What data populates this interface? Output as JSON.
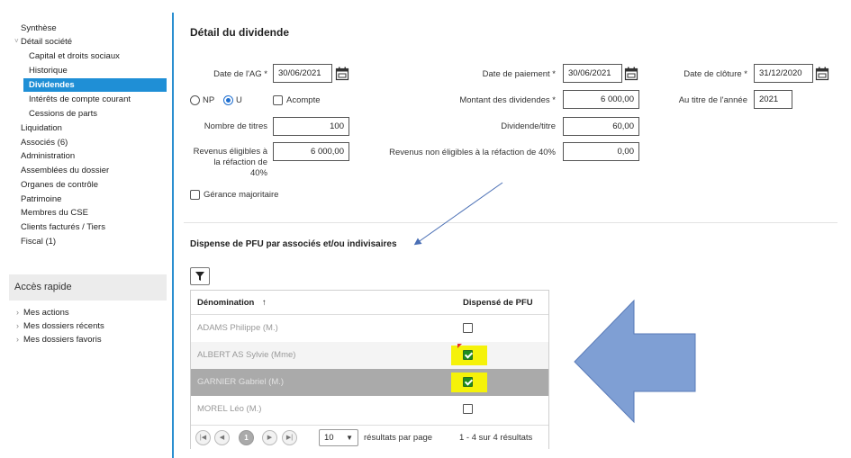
{
  "sidebar": {
    "items": [
      {
        "label": "Synthèse",
        "level": 1
      },
      {
        "label": "Détail société",
        "level": 1
      },
      {
        "label": "Capital et droits sociaux",
        "level": 2
      },
      {
        "label": "Historique",
        "level": 2
      },
      {
        "label": "Dividendes",
        "level": 2,
        "active": true
      },
      {
        "label": "Intérêts de compte courant",
        "level": 2
      },
      {
        "label": "Cessions de parts",
        "level": 2
      },
      {
        "label": "Liquidation",
        "level": 1
      },
      {
        "label": "Associés (6)",
        "level": 1
      },
      {
        "label": "Administration",
        "level": 1
      },
      {
        "label": "Assemblées du dossier",
        "level": 1
      },
      {
        "label": "Organes de contrôle",
        "level": 1
      },
      {
        "label": "Patrimoine",
        "level": 1
      },
      {
        "label": "Membres du CSE",
        "level": 1
      },
      {
        "label": "Clients facturés / Tiers",
        "level": 1
      },
      {
        "label": "Fiscal (1)",
        "level": 1
      }
    ],
    "quick_access": {
      "title": "Accès rapide",
      "items": [
        "Mes actions",
        "Mes dossiers récents",
        "Mes dossiers favoris"
      ]
    }
  },
  "main": {
    "title": "Détail du dividende",
    "date_ag": {
      "label": "Date de l'AG *",
      "value": "30/06/2021"
    },
    "date_paiement": {
      "label": "Date de paiement *",
      "value": "30/06/2021"
    },
    "date_cloture": {
      "label": "Date de clôture *",
      "value": "31/12/2020"
    },
    "radio_np": "NP",
    "radio_u": "U",
    "radio_selected": "U",
    "acompte": {
      "label": "Acompte",
      "checked": false
    },
    "montant": {
      "label": "Montant des dividendes *",
      "value": "6 000,00"
    },
    "annee": {
      "label": "Au titre de l'année",
      "value": "2021"
    },
    "nb_titres": {
      "label": "Nombre de titres",
      "value": "100"
    },
    "dividende_titre": {
      "label": "Dividende/titre",
      "value": "60,00"
    },
    "revenus_eligibles": {
      "label_line1": "Revenus éligibles à",
      "label_line2": "la réfaction de",
      "label_line3": "40%",
      "value": "6 000,00"
    },
    "revenus_non_eligibles": {
      "label": "Revenus non éligibles à la réfaction de 40%",
      "value": "0,00"
    },
    "gerance": {
      "label": "Gérance majoritaire",
      "checked": false
    },
    "subtitle": "Dispense de PFU par associés et/ou indivisaires",
    "grid": {
      "col_name": "Dénomination",
      "sort_icon": "↑",
      "col_pfu": "Dispensé de PFU",
      "rows": [
        {
          "name": "ADAMS Philippe (M.)",
          "dispense": false
        },
        {
          "name": "ALBERT AS Sylvie (Mme)",
          "dispense": true
        },
        {
          "name": "GARNIER Gabriel (M.)",
          "dispense": true,
          "selected": true
        },
        {
          "name": "MOREL Léo (M.)",
          "dispense": false
        }
      ],
      "pager": {
        "first": "|◀",
        "prev": "◀",
        "current_page": "1",
        "next": "▶",
        "last": "▶|",
        "per_page": "10",
        "per_page_caret": "▼",
        "per_page_label": "résultats par page",
        "summary": "1 - 4 sur 4 résultats"
      }
    }
  },
  "colors": {
    "accent": "#1f8fd6",
    "highlight": "#f5f20a",
    "arrow_fill": "#7f9fd4",
    "checkbox_green": "#1f8c1f"
  }
}
